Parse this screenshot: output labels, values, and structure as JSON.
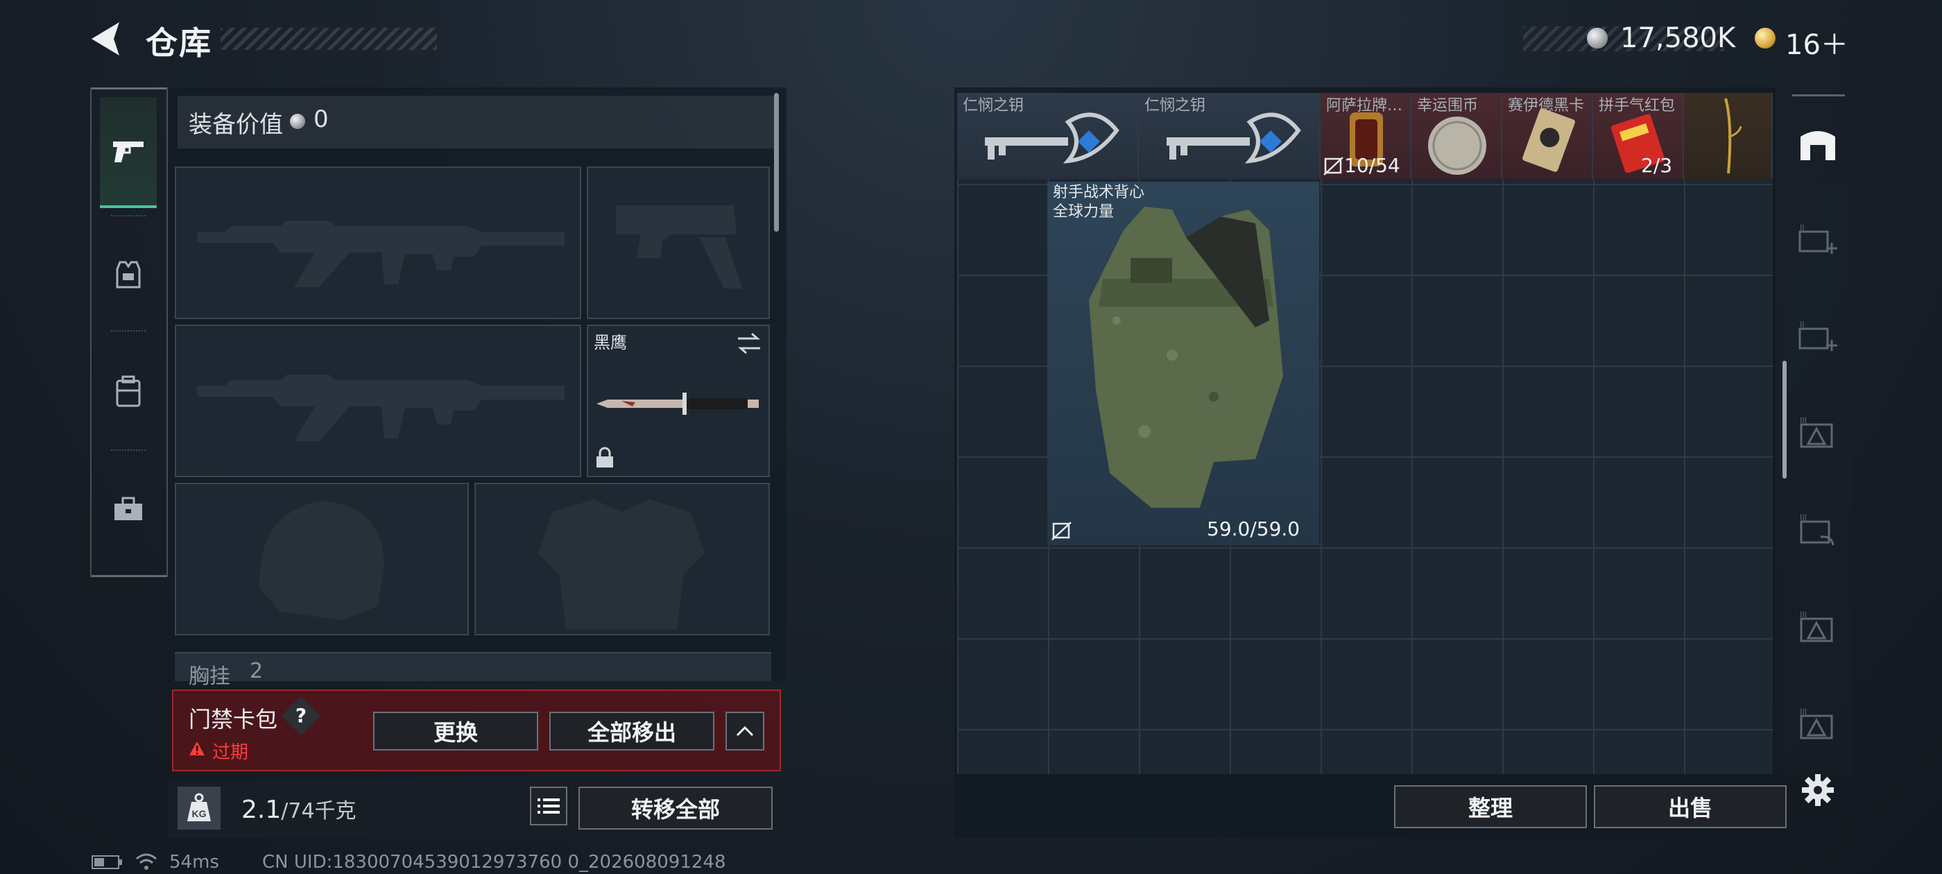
{
  "header": {
    "title": "仓库",
    "currency_silver": "17,580K",
    "currency_gold": "16＋"
  },
  "left_tabs": [
    "weapons-tab",
    "armor-tab",
    "backpack-tab",
    "toolbox-tab"
  ],
  "loadout": {
    "value_label": "装备价值",
    "value_amount": "0",
    "knife_name": "黑鹰",
    "chest_label": "胸挂",
    "chest_count": "2"
  },
  "keycard": {
    "label": "门禁卡包",
    "help": "?",
    "status": "过期",
    "replace_button": "更换",
    "move_all_button": "全部移出",
    "collapse_button": "^"
  },
  "weight": {
    "current": "2.1",
    "max": "/74千克",
    "transfer_all_button": "转移全部"
  },
  "status_bar": {
    "ping": "54ms",
    "uid": "CN UID:18300704539012973760 0_202608091248"
  },
  "stash": {
    "top_items": [
      {
        "name": "仁悯之钥",
        "count": ""
      },
      {
        "name": "仁悯之钥",
        "count": ""
      },
      {
        "name": "阿萨拉牌…",
        "count": "10/54"
      },
      {
        "name": "幸运围币",
        "count": ""
      },
      {
        "name": "赛伊德黑卡",
        "count": ""
      },
      {
        "name": "拼手气红包",
        "count": "2/3"
      },
      {
        "name": "",
        "count": ""
      }
    ],
    "vest": {
      "name_line1": "射手战术背心",
      "name_line2": "全球力量",
      "durability": "59.0/59.0"
    },
    "sort_button": "整理",
    "sell_button": "出售"
  },
  "colors": {
    "accent_green": "#46c49c",
    "warning_red": "#ff3b3b",
    "keycard_bg": "#5a1418"
  }
}
